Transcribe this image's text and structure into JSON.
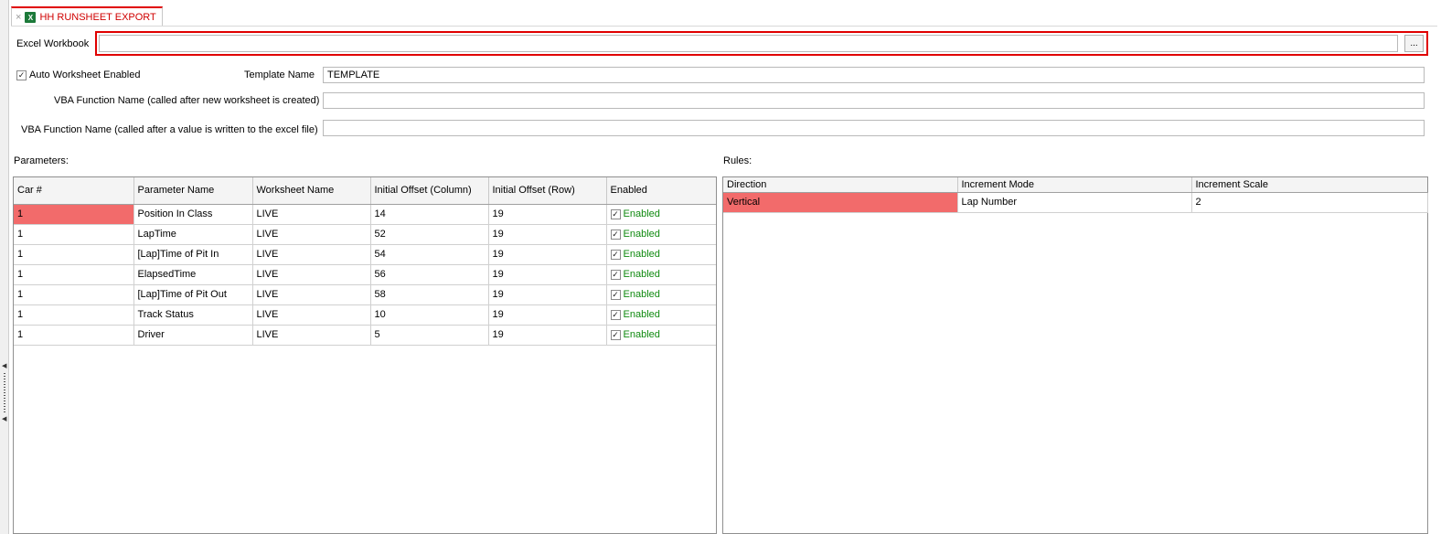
{
  "tab": {
    "title": "HH RUNSHEET EXPORT"
  },
  "workbook": {
    "label": "Excel Workbook",
    "value": "",
    "browse_label": "..."
  },
  "auto_worksheet": {
    "label": "Auto Worksheet Enabled",
    "checked": true
  },
  "template": {
    "label": "Template Name",
    "value": "TEMPLATE"
  },
  "vba_new": {
    "label": "VBA Function Name (called after new worksheet is created)",
    "value": ""
  },
  "vba_value": {
    "label": "VBA Function Name (called after a value is written to the excel file)",
    "value": ""
  },
  "parameters": {
    "label": "Parameters:",
    "columns": [
      "Car #",
      "Parameter Name",
      "Worksheet Name",
      "Initial Offset (Column)",
      "Initial Offset (Row)",
      "Enabled"
    ],
    "rows": [
      {
        "car": "1",
        "name": "Position In Class",
        "worksheet": "LIVE",
        "col": "14",
        "row": "19",
        "enabled": "Enabled"
      },
      {
        "car": "1",
        "name": "LapTime",
        "worksheet": "LIVE",
        "col": "52",
        "row": "19",
        "enabled": "Enabled"
      },
      {
        "car": "1",
        "name": "[Lap]Time of Pit In",
        "worksheet": "LIVE",
        "col": "54",
        "row": "19",
        "enabled": "Enabled"
      },
      {
        "car": "1",
        "name": "ElapsedTime",
        "worksheet": "LIVE",
        "col": "56",
        "row": "19",
        "enabled": "Enabled"
      },
      {
        "car": "1",
        "name": "[Lap]Time of Pit Out",
        "worksheet": "LIVE",
        "col": "58",
        "row": "19",
        "enabled": "Enabled"
      },
      {
        "car": "1",
        "name": "Track Status",
        "worksheet": "LIVE",
        "col": "10",
        "row": "19",
        "enabled": "Enabled"
      },
      {
        "car": "1",
        "name": "Driver",
        "worksheet": "LIVE",
        "col": "5",
        "row": "19",
        "enabled": "Enabled"
      }
    ]
  },
  "rules": {
    "label": "Rules:",
    "columns": [
      "Direction",
      "Increment Mode",
      "Increment Scale"
    ],
    "rows": [
      {
        "direction": "Vertical",
        "mode": "Lap Number",
        "scale": "2"
      }
    ]
  },
  "colors": {
    "accent": "#e00000",
    "selected_cell": "#f26b6b",
    "enabled_text": "#108a10"
  }
}
